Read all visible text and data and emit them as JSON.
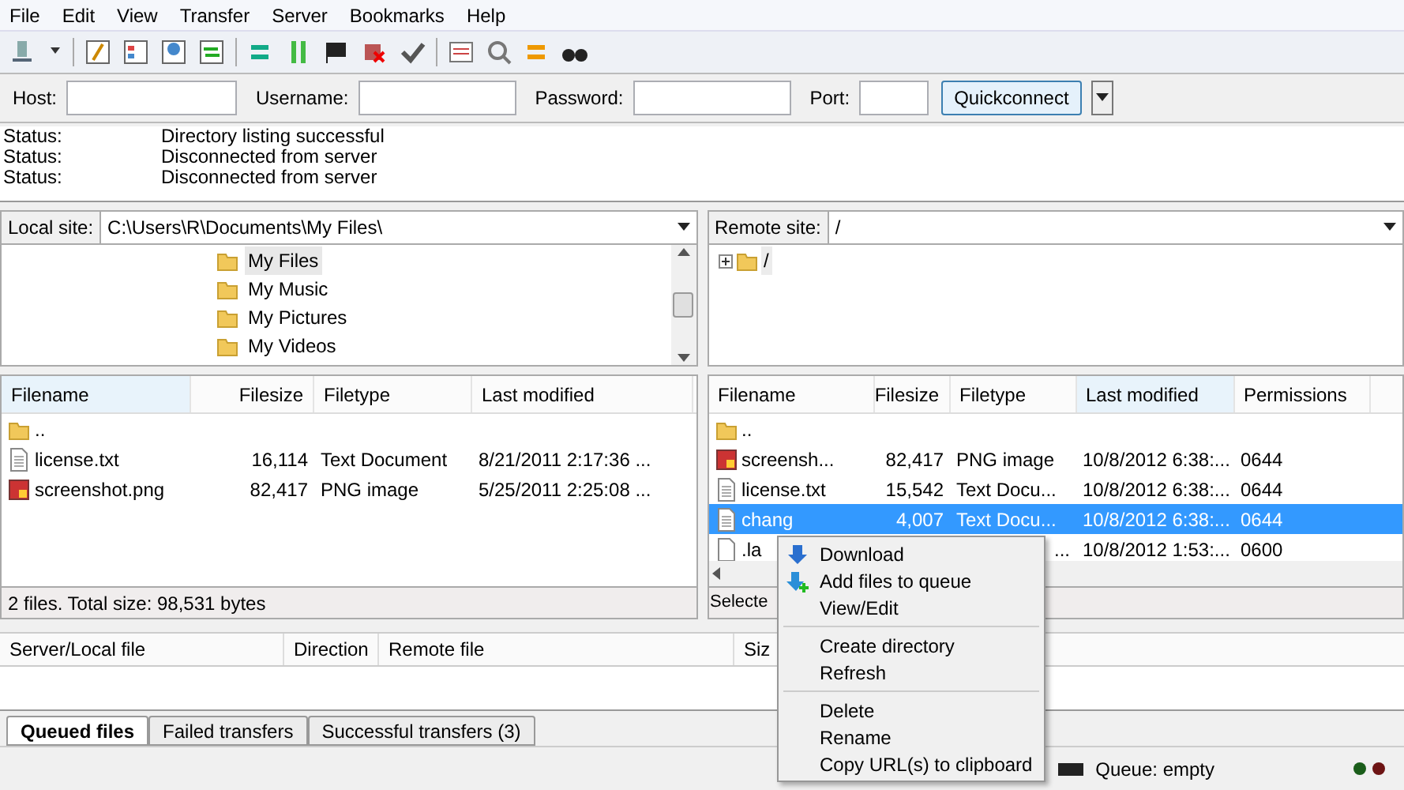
{
  "menu_bar": [
    "File",
    "Edit",
    "View",
    "Transfer",
    "Server",
    "Bookmarks",
    "Help"
  ],
  "quickconnect": {
    "host_label": "Host:",
    "username_label": "Username:",
    "password_label": "Password:",
    "port_label": "Port:",
    "button": "Quickconnect"
  },
  "log": [
    {
      "label": "Status:",
      "message": "Directory listing successful"
    },
    {
      "label": "Status:",
      "message": "Disconnected from server"
    },
    {
      "label": "Status:",
      "message": "Disconnected from server"
    }
  ],
  "local": {
    "site_label": "Local site:",
    "path": "C:\\Users\\R\\Documents\\My Files\\",
    "tree": [
      {
        "name": "My Files",
        "selected": true
      },
      {
        "name": "My Music",
        "selected": false
      },
      {
        "name": "My Pictures",
        "selected": false
      },
      {
        "name": "My Videos",
        "selected": false
      }
    ],
    "columns": [
      "Filename",
      "Filesize",
      "Filetype",
      "Last modified"
    ],
    "rows": [
      {
        "kind": "folder",
        "filename": "..",
        "selected": false
      },
      {
        "kind": "text",
        "filename": "license.txt",
        "filesize": "16,114",
        "filetype": "Text Document",
        "last_modified": "8/21/2011 2:17:36 ...",
        "selected": false
      },
      {
        "kind": "image",
        "filename": "screenshot.png",
        "filesize": "82,417",
        "filetype": "PNG image",
        "last_modified": "5/25/2011 2:25:08 ...",
        "selected": false
      }
    ],
    "status": "2 files. Total size: 98,531 bytes"
  },
  "remote": {
    "site_label": "Remote site:",
    "path": "/",
    "tree": [
      {
        "name": "/",
        "expanded": false
      }
    ],
    "columns": [
      "Filename",
      "Filesize",
      "Filetype",
      "Last modified",
      "Permissions"
    ],
    "rows": [
      {
        "kind": "folder",
        "filename": "..",
        "selected": false
      },
      {
        "kind": "image",
        "filename": "screensh...",
        "filesize": "82,417",
        "filetype": "PNG image",
        "last_modified": "10/8/2012 6:38:...",
        "permissions": "0644",
        "selected": false
      },
      {
        "kind": "text",
        "filename": "license.txt",
        "filesize": "15,542",
        "filetype": "Text Docu...",
        "last_modified": "10/8/2012 6:38:...",
        "permissions": "0644",
        "selected": false
      },
      {
        "kind": "text",
        "filename": "chang",
        "filesize": "4,007",
        "filetype": "Text Docu...",
        "last_modified": "10/8/2012 6:38:...",
        "permissions": "0644",
        "selected": true
      },
      {
        "kind": "file",
        "filename": ".la",
        "filetype": "...",
        "last_modified": "10/8/2012 1:53:...",
        "permissions": "0600",
        "selected": false
      }
    ],
    "status": "Selecte"
  },
  "context_menu": [
    {
      "kind": "download",
      "label": "Download"
    },
    {
      "kind": "enqueue",
      "label": "Add files to queue"
    },
    {
      "kind": "item",
      "label": "View/Edit"
    },
    {
      "kind": "separator"
    },
    {
      "kind": "item",
      "label": "Create directory"
    },
    {
      "kind": "item",
      "label": "Refresh"
    },
    {
      "kind": "separator"
    },
    {
      "kind": "item",
      "label": "Delete"
    },
    {
      "kind": "item",
      "label": "Rename"
    },
    {
      "kind": "item",
      "label": "Copy URL(s) to clipboard"
    }
  ],
  "queue_columns": [
    "Server/Local file",
    "Direction",
    "Remote file",
    "Siz"
  ],
  "queue_tabs": [
    {
      "label": "Queued files",
      "selected": true
    },
    {
      "label": "Failed transfers",
      "selected": false
    },
    {
      "label": "Successful transfers (3)",
      "selected": false
    }
  ],
  "status_bar": {
    "queue": "Queue: empty"
  }
}
